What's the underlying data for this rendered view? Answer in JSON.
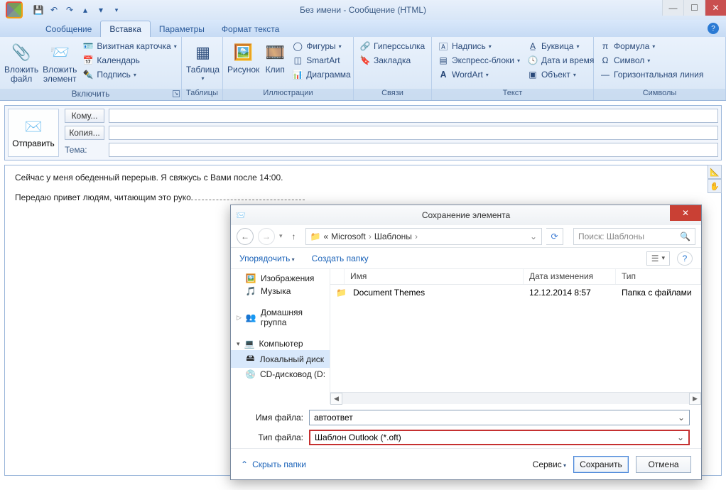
{
  "window": {
    "title": "Без имени - Сообщение (HTML)"
  },
  "ribbon_tabs": {
    "t0": "Сообщение",
    "t1": "Вставка",
    "t2": "Параметры",
    "t3": "Формат текста"
  },
  "groups": {
    "include": {
      "attach_file": "Вложить файл",
      "attach_item": "Вложить элемент",
      "bizcard": "Визитная карточка",
      "calendar": "Календарь",
      "signature": "Подпись",
      "label": "Включить"
    },
    "tables": {
      "table": "Таблица",
      "label": "Таблицы"
    },
    "illu": {
      "picture": "Рисунок",
      "clip": "Клип",
      "shapes": "Фигуры",
      "smartart": "SmartArt",
      "chart": "Диаграмма",
      "label": "Иллюстрации"
    },
    "links": {
      "hyperlink": "Гиперссылка",
      "bookmark": "Закладка",
      "label": "Связи"
    },
    "text": {
      "textbox": "Надпись",
      "quick": "Экспресс-блоки",
      "wordart": "WordArt",
      "dropcap": "Буквица",
      "datetime": "Дата и время",
      "object": "Объект",
      "label": "Текст"
    },
    "symbols": {
      "equation": "Формула",
      "symbol": "Символ",
      "hline": "Горизонтальная линия",
      "label": "Символы"
    }
  },
  "compose": {
    "send": "Отправить",
    "to": "Кому...",
    "cc": "Копия...",
    "subject": "Тема:"
  },
  "body": {
    "l1": "Сейчас у меня обеденный перерыв. Я свяжусь с Вами после 14:00.",
    "l2": "Передаю привет людям, читающим это руко"
  },
  "dialog": {
    "title": "Сохранение элемента",
    "crumb_pre": "«",
    "crumb1": "Microsoft",
    "crumb2": "Шаблоны",
    "search_ph": "Поиск: Шаблоны",
    "organize": "Упорядочить",
    "newfolder": "Создать папку",
    "nav": {
      "pictures": "Изображения",
      "music": "Музыка",
      "homegroup": "Домашняя группа",
      "computer": "Компьютер",
      "localdisk": "Локальный диск",
      "cddrive": "CD-дисковод (D:"
    },
    "cols": {
      "name": "Имя",
      "date": "Дата изменения",
      "type": "Тип"
    },
    "row": {
      "name": "Document Themes",
      "date": "12.12.2014 8:57",
      "type": "Папка с файлами"
    },
    "fname_label": "Имя файла:",
    "fname_value": "автоответ",
    "ftype_label": "Тип файла:",
    "ftype_value": "Шаблон Outlook (*.oft)",
    "hide": "Скрыть папки",
    "tools": "Сервис",
    "save": "Сохранить",
    "cancel": "Отмена"
  }
}
